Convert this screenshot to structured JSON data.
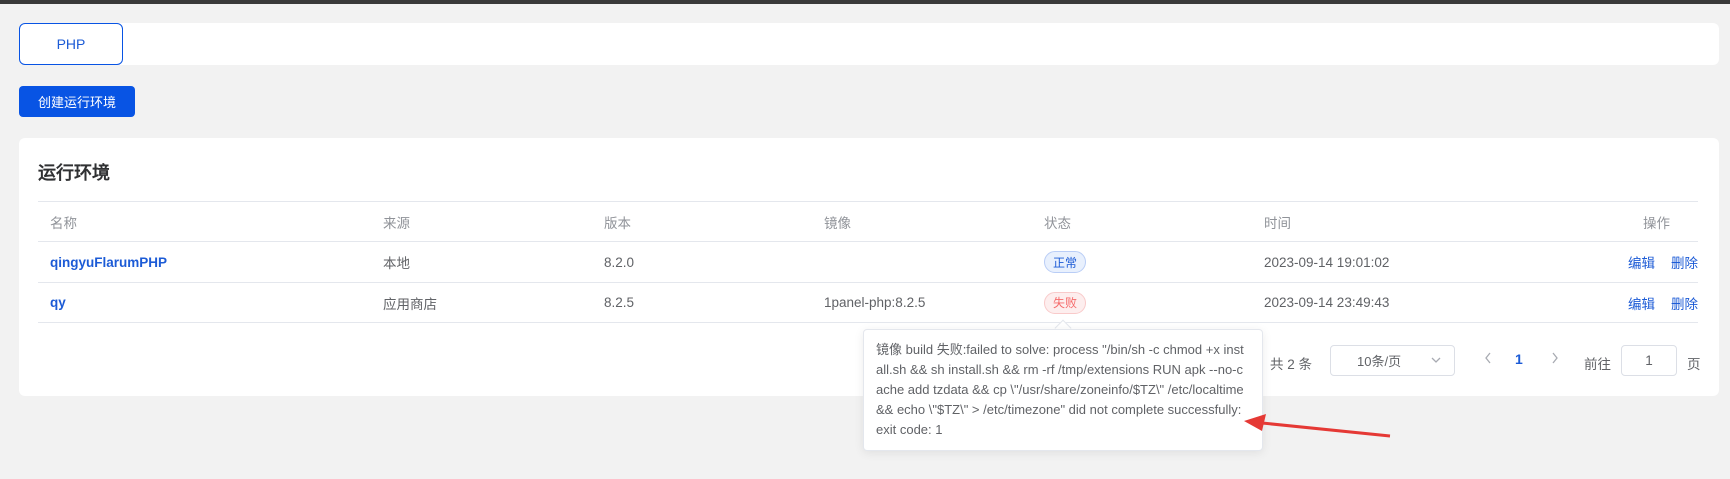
{
  "tabs": [
    {
      "label": "PHP"
    }
  ],
  "toolbar": {
    "create_label": "创建运行环境"
  },
  "card": {
    "title": "运行环境"
  },
  "table": {
    "headers": {
      "name": "名称",
      "source": "来源",
      "version": "版本",
      "image": "镜像",
      "status": "状态",
      "time": "时间",
      "ops": "操作"
    },
    "rows": [
      {
        "name": "qingyuFlarumPHP",
        "source": "本地",
        "version": "8.2.0",
        "image": "",
        "status": "正常",
        "status_kind": "ok",
        "time": "2023-09-14 19:01:02",
        "edit": "编辑",
        "delete": "删除"
      },
      {
        "name": "qy",
        "source": "应用商店",
        "version": "8.2.5",
        "image": "1panel-php:8.2.5",
        "status": "失败",
        "status_kind": "fail",
        "time": "2023-09-14 23:49:43",
        "edit": "编辑",
        "delete": "删除"
      }
    ]
  },
  "pagination": {
    "total": "共 2 条",
    "page_size": "10条/页",
    "current_page": "1",
    "goto_label": "前往",
    "goto_value": "1",
    "page_unit": "页"
  },
  "tooltip": {
    "text": "镜像 build 失败:failed to solve: process \"/bin/sh -c chmod +x install.sh && sh install.sh && rm -rf /tmp/extensions RUN apk --no-cache add tzdata && cp \\\"/usr/share/zoneinfo/$TZ\\\" /etc/localtime && echo \\\"$TZ\\\" > /etc/timezone\" did not complete successfully: exit code: 1"
  },
  "colors": {
    "primary": "#0854e4",
    "link": "#1c5bd6",
    "fail": "#f56c6c",
    "annotation_arrow": "#e53935"
  },
  "icons": {
    "prev": "chevron-left-icon",
    "next": "chevron-right-icon",
    "select": "chevron-down-icon"
  }
}
